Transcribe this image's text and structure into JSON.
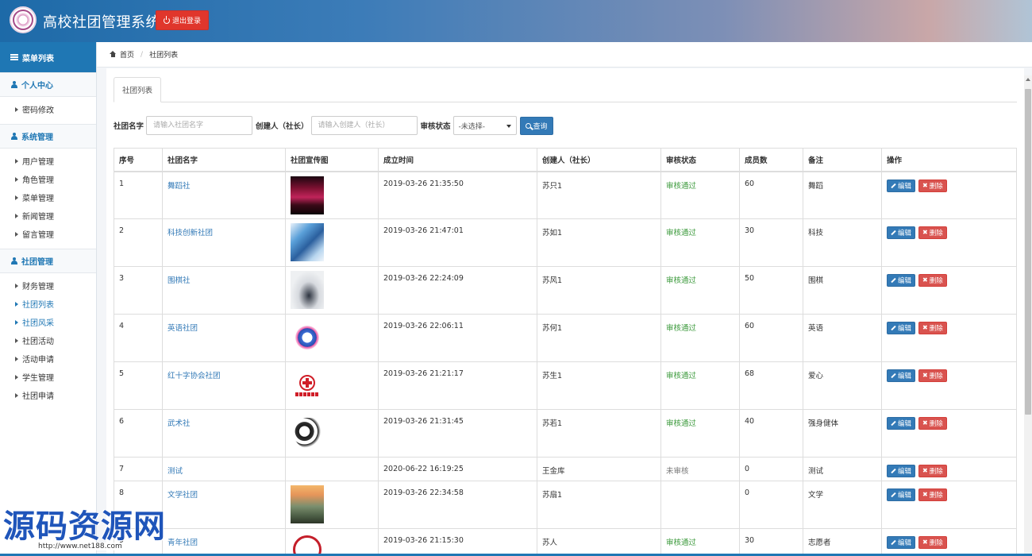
{
  "header": {
    "title": "高校社团管理系统",
    "logout_label": "退出登录"
  },
  "sidebar": {
    "heading": "菜单列表",
    "groups": [
      {
        "label": "个人中心",
        "items": [
          "密码修改"
        ]
      },
      {
        "label": "系统管理",
        "items": [
          "用户管理",
          "角色管理",
          "菜单管理",
          "新闻管理",
          "留言管理"
        ]
      },
      {
        "label": "社团管理",
        "items": [
          "财务管理",
          "社团列表",
          "社团风采",
          "社团活动",
          "活动申请",
          "学生管理",
          "社团申请"
        ]
      }
    ]
  },
  "breadcrumb": {
    "home": "首页",
    "current": "社团列表"
  },
  "tab": {
    "label": "社团列表"
  },
  "search": {
    "name_label": "社团名字",
    "name_placeholder": "请输入社团名字",
    "creator_label": "创建人（社长）",
    "creator_placeholder": "请输入创建人（社长）",
    "status_label": "审核状态",
    "status_selected": "-未选择-",
    "query_label": "查询"
  },
  "table": {
    "headers": [
      "序号",
      "社团名字",
      "社团宣传图",
      "成立时间",
      "创建人（社长）",
      "审核状态",
      "成员数",
      "备注",
      "操作"
    ],
    "edit_label": "编辑",
    "delete_label": "删除",
    "rows": [
      {
        "no": "1",
        "name": "舞蹈社",
        "image": "dance",
        "time": "2019-03-26 21:35:50",
        "creator": "苏只1",
        "status": "审核通过",
        "members": "60",
        "note": "舞蹈"
      },
      {
        "no": "2",
        "name": "科技创新社团",
        "image": "tech",
        "time": "2019-03-26 21:47:01",
        "creator": "苏如1",
        "status": "审核通过",
        "members": "30",
        "note": "科技"
      },
      {
        "no": "3",
        "name": "围棋社",
        "image": "go",
        "time": "2019-03-26 22:24:09",
        "creator": "苏风1",
        "status": "审核通过",
        "members": "50",
        "note": "围棋"
      },
      {
        "no": "4",
        "name": "英语社团",
        "image": "eng",
        "time": "2019-03-26 22:06:11",
        "creator": "苏何1",
        "status": "审核通过",
        "members": "60",
        "note": "英语"
      },
      {
        "no": "5",
        "name": "红十字协会社团",
        "image": "red",
        "time": "2019-03-26 21:21:17",
        "creator": "苏生1",
        "status": "审核通过",
        "members": "68",
        "note": "爱心"
      },
      {
        "no": "6",
        "name": "武术社",
        "image": "wushu",
        "time": "2019-03-26 21:31:45",
        "creator": "苏若1",
        "status": "审核通过",
        "members": "40",
        "note": "强身健体"
      },
      {
        "no": "7",
        "name": "测试",
        "image": "",
        "time": "2020-06-22 16:19:25",
        "creator": "王金库",
        "status": "未审核",
        "members": "0",
        "note": "测试"
      },
      {
        "no": "8",
        "name": "文学社团",
        "image": "lit",
        "time": "2019-03-26 22:34:58",
        "creator": "苏扇1",
        "status": "",
        "members": "0",
        "note": "文学"
      },
      {
        "no": "9",
        "name": "青年社团",
        "image": "youth",
        "time": "2019-03-26 21:15:30",
        "creator": "苏人",
        "status": "审核通过",
        "members": "30",
        "note": "志愿者"
      }
    ]
  },
  "watermark": {
    "text": "源码资源网",
    "url": "http://www.net188.com"
  }
}
